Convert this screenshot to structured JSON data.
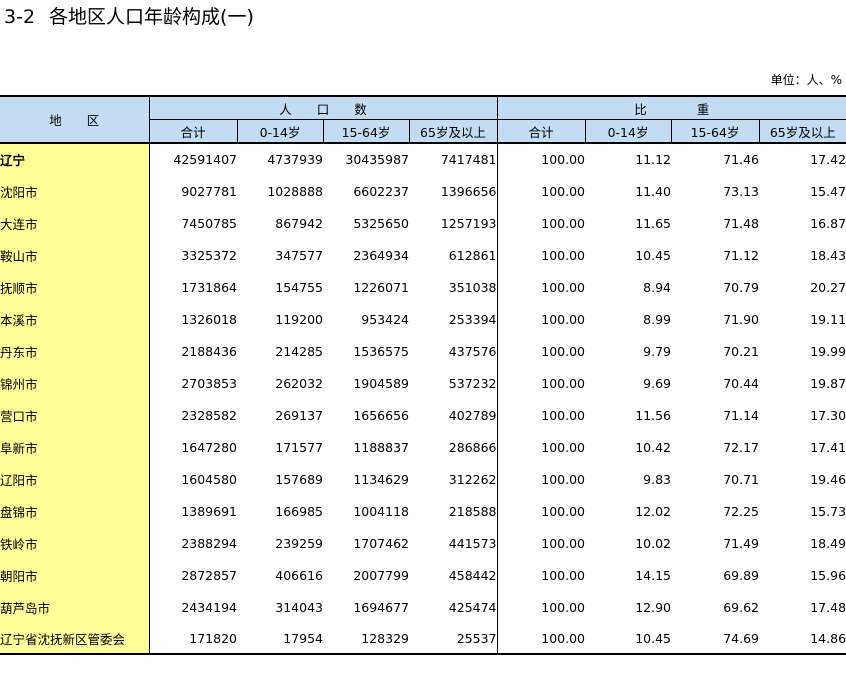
{
  "title": {
    "number": "3-2",
    "text": "各地区人口年龄构成(一)"
  },
  "unit": "单位：人、%",
  "headers": {
    "region": "地　　区",
    "population_group": "人　　口　　数",
    "share_group": "比　　　　重",
    "columns": [
      "合计",
      "0-14岁",
      "15-64岁",
      "65岁及以上",
      "合计",
      "0-14岁",
      "15-64岁",
      "65岁及以上"
    ]
  },
  "rows": [
    {
      "region": "辽宁",
      "bold": true,
      "values": [
        "42591407",
        "4737939",
        "30435987",
        "7417481",
        "100.00",
        "11.12",
        "71.46",
        "17.42"
      ]
    },
    {
      "region": "沈阳市",
      "values": [
        "9027781",
        "1028888",
        "6602237",
        "1396656",
        "100.00",
        "11.40",
        "73.13",
        "15.47"
      ]
    },
    {
      "region": "大连市",
      "values": [
        "7450785",
        "867942",
        "5325650",
        "1257193",
        "100.00",
        "11.65",
        "71.48",
        "16.87"
      ]
    },
    {
      "region": "鞍山市",
      "values": [
        "3325372",
        "347577",
        "2364934",
        "612861",
        "100.00",
        "10.45",
        "71.12",
        "18.43"
      ]
    },
    {
      "region": "抚顺市",
      "values": [
        "1731864",
        "154755",
        "1226071",
        "351038",
        "100.00",
        "8.94",
        "70.79",
        "20.27"
      ]
    },
    {
      "region": "本溪市",
      "values": [
        "1326018",
        "119200",
        "953424",
        "253394",
        "100.00",
        "8.99",
        "71.90",
        "19.11"
      ]
    },
    {
      "region": "丹东市",
      "values": [
        "2188436",
        "214285",
        "1536575",
        "437576",
        "100.00",
        "9.79",
        "70.21",
        "19.99"
      ]
    },
    {
      "region": "锦州市",
      "values": [
        "2703853",
        "262032",
        "1904589",
        "537232",
        "100.00",
        "9.69",
        "70.44",
        "19.87"
      ]
    },
    {
      "region": "营口市",
      "values": [
        "2328582",
        "269137",
        "1656656",
        "402789",
        "100.00",
        "11.56",
        "71.14",
        "17.30"
      ]
    },
    {
      "region": "阜新市",
      "values": [
        "1647280",
        "171577",
        "1188837",
        "286866",
        "100.00",
        "10.42",
        "72.17",
        "17.41"
      ]
    },
    {
      "region": "辽阳市",
      "values": [
        "1604580",
        "157689",
        "1134629",
        "312262",
        "100.00",
        "9.83",
        "70.71",
        "19.46"
      ]
    },
    {
      "region": "盘锦市",
      "values": [
        "1389691",
        "166985",
        "1004118",
        "218588",
        "100.00",
        "12.02",
        "72.25",
        "15.73"
      ]
    },
    {
      "region": "铁岭市",
      "values": [
        "2388294",
        "239259",
        "1707462",
        "441573",
        "100.00",
        "10.02",
        "71.49",
        "18.49"
      ]
    },
    {
      "region": "朝阳市",
      "values": [
        "2872857",
        "406616",
        "2007799",
        "458442",
        "100.00",
        "14.15",
        "69.89",
        "15.96"
      ]
    },
    {
      "region": "葫芦岛市",
      "values": [
        "2434194",
        "314043",
        "1694677",
        "425474",
        "100.00",
        "12.90",
        "69.62",
        "17.48"
      ]
    },
    {
      "region": "辽宁省沈抚新区管委会",
      "values": [
        "171820",
        "17954",
        "128329",
        "25537",
        "100.00",
        "10.45",
        "74.69",
        "14.86"
      ]
    }
  ]
}
